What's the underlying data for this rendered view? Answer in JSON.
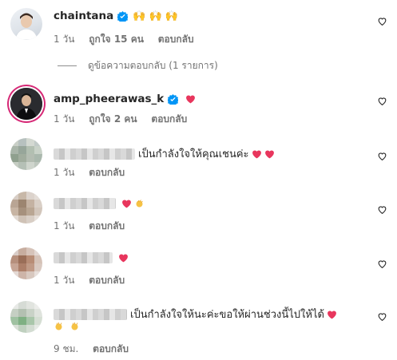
{
  "comments": [
    {
      "username": "chaintana",
      "verified": true,
      "text": "🙌 🙌 🙌",
      "time": "1 วัน",
      "likes": "ถูกใจ 15 คน",
      "reply_label": "ตอบกลับ",
      "view_replies": "ดูข้อความตอบกลับ (1 รายการ)"
    },
    {
      "username": "amp_pheerawas_k",
      "verified": true,
      "time": "1 วัน",
      "likes": "ถูกใจ 2 คน",
      "reply_label": "ตอบกลับ"
    },
    {
      "text": "เป็นกำลังใจให้คุณเชนค่ะ",
      "time": "1 วัน",
      "reply_label": "ตอบกลับ"
    },
    {
      "time": "1 วัน",
      "reply_label": "ตอบกลับ"
    },
    {
      "time": "1 วัน",
      "reply_label": "ตอบกลับ"
    },
    {
      "text": "เป็นกำลังใจให้นะค่ะขอให้ผ่านช่วงนี้ไปให้ได้",
      "time": "9 ชม.",
      "reply_label": "ตอบกลับ"
    }
  ],
  "colors": {
    "verified": "#0095f6",
    "heart": "#ed4956",
    "meta": "#737373",
    "ring": "#d62976"
  }
}
